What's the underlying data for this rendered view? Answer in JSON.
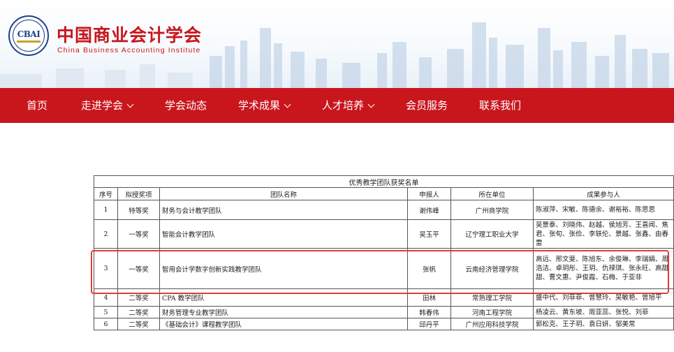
{
  "site": {
    "title": "中国商业会计学会",
    "subtitle": "China Business Accounting Institute",
    "logo_text": "CBAI"
  },
  "nav": {
    "items": [
      {
        "label": "首页",
        "dropdown": false
      },
      {
        "label": "走进学会",
        "dropdown": true
      },
      {
        "label": "学会动态",
        "dropdown": false
      },
      {
        "label": "学术成果",
        "dropdown": true
      },
      {
        "label": "人才培养",
        "dropdown": true
      },
      {
        "label": "会员服务",
        "dropdown": false
      },
      {
        "label": "联系我们",
        "dropdown": false
      }
    ]
  },
  "table": {
    "title": "优秀教学团队获奖名单",
    "headers": [
      "序号",
      "拟授奖项",
      "团队名称",
      "申报人",
      "所在单位",
      "成果参与人"
    ],
    "rows": [
      {
        "no": "1",
        "award": "特等奖",
        "team": "财务与会计教学团队",
        "applicant": "谢伟峰",
        "unit": "广州商学院",
        "members": "陈淑萍、宋敏、陈德余、谢裕裕、陈思思"
      },
      {
        "no": "2",
        "award": "一等奖",
        "team": "智能会计教学团队",
        "applicant": "吴玉平",
        "unit": "辽宁理工职业大学",
        "members": "吴景泰、刘晓伟、赵越、侯旭芳、王喜闻、焦君、张旬、张俭、李轶伦、景越、张鑫、由春雷"
      },
      {
        "no": "3",
        "award": "一等奖",
        "team": "智用会计学数字创新实践教学团队",
        "applicant": "张帆",
        "unit": "云南经济管理学院",
        "members": "高远、邢文斐、陈旭东、余俊琳、李瑞娟、周浩洁、卓玥彤、王玥、仇禄琪、张永旺、高甜甜、曹文惠、尹俊霞、石梅、于亚非"
      },
      {
        "no": "4",
        "award": "二等奖",
        "team": "CPA 教学团队",
        "applicant": "田林",
        "unit": "常熟理工学院",
        "members": "盛中代、刘菲菲、曾慧玲、吴敏艳、曾旭平"
      },
      {
        "no": "5",
        "award": "二等奖",
        "team": "财务管理专业教学团队",
        "applicant": "韩春伟",
        "unit": "河南工程学院",
        "members": "杨凌云、黄东坡、周亚蕊、张悦、刘菲"
      },
      {
        "no": "6",
        "award": "二等奖",
        "team": "《基础会计》课程教学团队",
        "applicant": "邱丹平",
        "unit": "广州应用科技学院",
        "members": "郭松克、王子玥、袁日妍、邹美常"
      }
    ]
  },
  "colors": {
    "brand_red": "#c9161d",
    "logo_blue": "#1d3f8c",
    "highlight": "#e03b3b"
  }
}
